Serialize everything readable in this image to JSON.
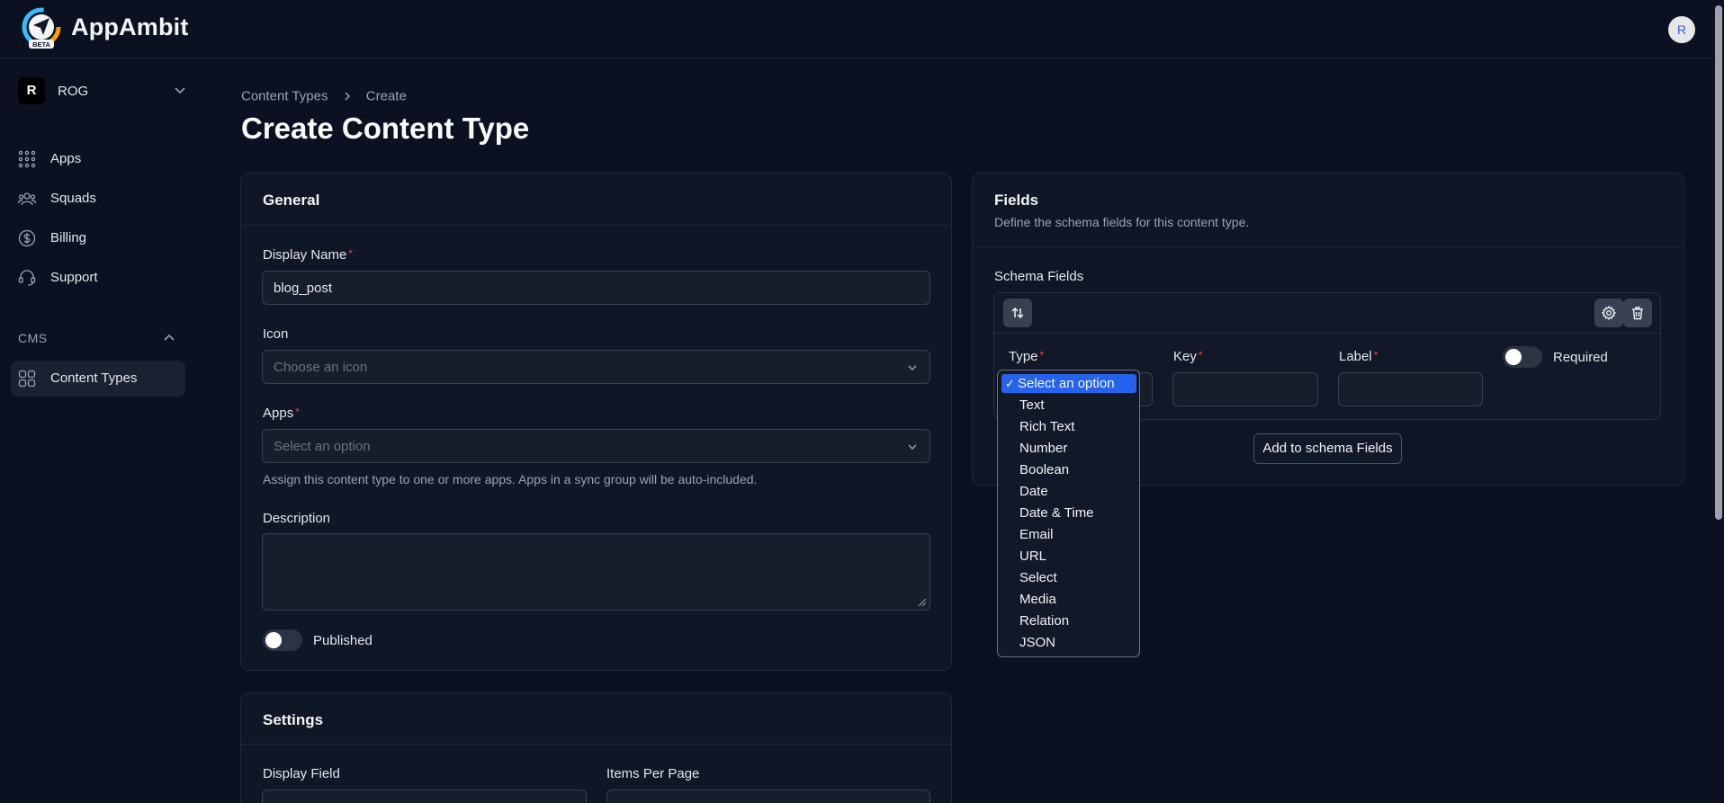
{
  "app": {
    "name": "AppAmbit",
    "badge": "BETA",
    "avatar_initial": "R"
  },
  "team": {
    "initial": "R",
    "name": "ROG"
  },
  "sidebar": {
    "items": [
      {
        "label": "Apps",
        "icon": "grid-dots-icon"
      },
      {
        "label": "Squads",
        "icon": "users-icon"
      },
      {
        "label": "Billing",
        "icon": "dollar-circle-icon"
      },
      {
        "label": "Support",
        "icon": "headset-icon"
      }
    ],
    "section_label": "CMS",
    "section_items": [
      {
        "label": "Content Types",
        "icon": "squares-icon",
        "active": true
      }
    ]
  },
  "breadcrumb": {
    "parent": "Content Types",
    "current": "Create"
  },
  "page": {
    "title": "Create Content Type"
  },
  "general": {
    "title": "General",
    "display_name_label": "Display Name",
    "display_name_value": "blog_post",
    "icon_label": "Icon",
    "icon_placeholder": "Choose an icon",
    "apps_label": "Apps",
    "apps_placeholder": "Select an option",
    "apps_helper": "Assign this content type to one or more apps. Apps in a sync group will be auto-included.",
    "description_label": "Description",
    "published_label": "Published",
    "published": false
  },
  "settings": {
    "title": "Settings",
    "display_field_label": "Display Field",
    "items_per_page_label": "Items Per Page"
  },
  "fields": {
    "title": "Fields",
    "subtitle": "Define the schema fields for this content type.",
    "schema_label": "Schema Fields",
    "type_label": "Type",
    "key_label": "Key",
    "label_label": "Label",
    "required_label": "Required",
    "required": false,
    "add_button": "Add to schema Fields"
  },
  "type_dropdown": {
    "selected": "Select an option",
    "options": [
      "Select an option",
      "Text",
      "Rich Text",
      "Number",
      "Boolean",
      "Date",
      "Date & Time",
      "Email",
      "URL",
      "Select",
      "Media",
      "Relation",
      "JSON"
    ]
  },
  "colors": {
    "accent": "#2563eb",
    "background": "#0b1120",
    "required": "#ef4444"
  }
}
